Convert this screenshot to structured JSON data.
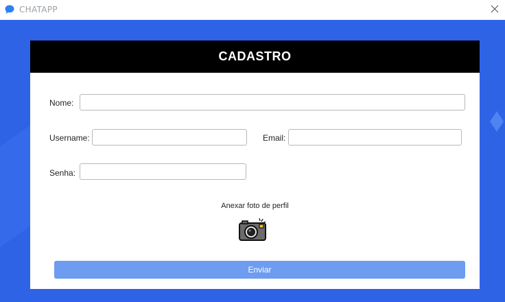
{
  "window": {
    "title": "CHATAPP",
    "app_icon": "chat-bubble-icon",
    "close_icon": "close-icon"
  },
  "colors": {
    "background_blue": "#2f63e6",
    "header_black": "#000000",
    "button_blue": "#6d9cf0"
  },
  "form": {
    "title": "CADASTRO",
    "nome_label": "Nome:",
    "nome_value": "",
    "username_label": "Username:",
    "username_value": "",
    "email_label": "Email:",
    "email_value": "",
    "senha_label": "Senha:",
    "senha_value": "",
    "anexar_label": "Anexar foto de perfil",
    "camera_icon": "camera-icon",
    "submit_label": "Enviar"
  }
}
